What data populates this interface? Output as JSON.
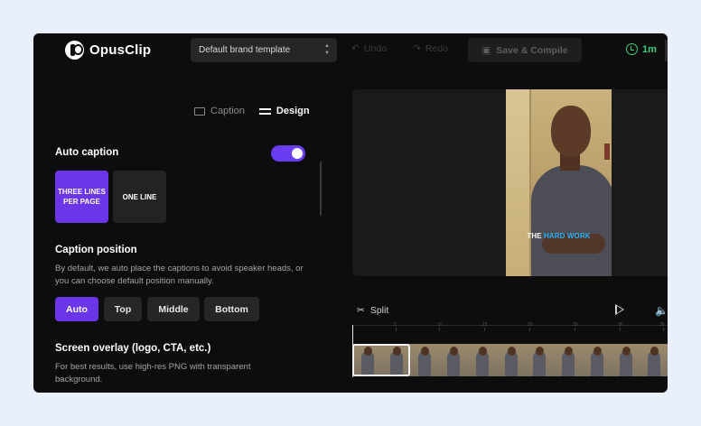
{
  "header": {
    "app_name": "OpusClip",
    "template": "Default brand template",
    "undo": "Undo",
    "redo": "Redo",
    "save": "Save & Compile",
    "credits": "1m"
  },
  "tabs": {
    "caption": "Caption",
    "design": "Design",
    "active": "Design"
  },
  "auto_caption": {
    "label": "Auto caption",
    "enabled": true,
    "styles": [
      {
        "label": "THREE LINES PER PAGE",
        "selected": true
      },
      {
        "label": "ONE LINE",
        "selected": false
      }
    ]
  },
  "caption_position": {
    "title": "Caption position",
    "description": "By default, we auto place the captions to avoid speaker heads, or you can choose default position manually.",
    "options": [
      "Auto",
      "Top",
      "Middle",
      "Bottom"
    ],
    "selected": "Auto"
  },
  "screen_overlay": {
    "title": "Screen overlay (logo, CTA, etc.)",
    "description": "For best results, use high-res PNG with transparent background."
  },
  "preview": {
    "caption_word_1": "THE",
    "caption_word_2": "HARD WORK"
  },
  "timeline": {
    "split_label": "Split",
    "tick_labels": [
      "5",
      "10",
      "15",
      "20",
      "25",
      "30",
      "35"
    ]
  },
  "colors": {
    "accent_purple": "#6b35e8",
    "credits_green": "#36d07c",
    "caption_highlight": "#26b5ff"
  }
}
